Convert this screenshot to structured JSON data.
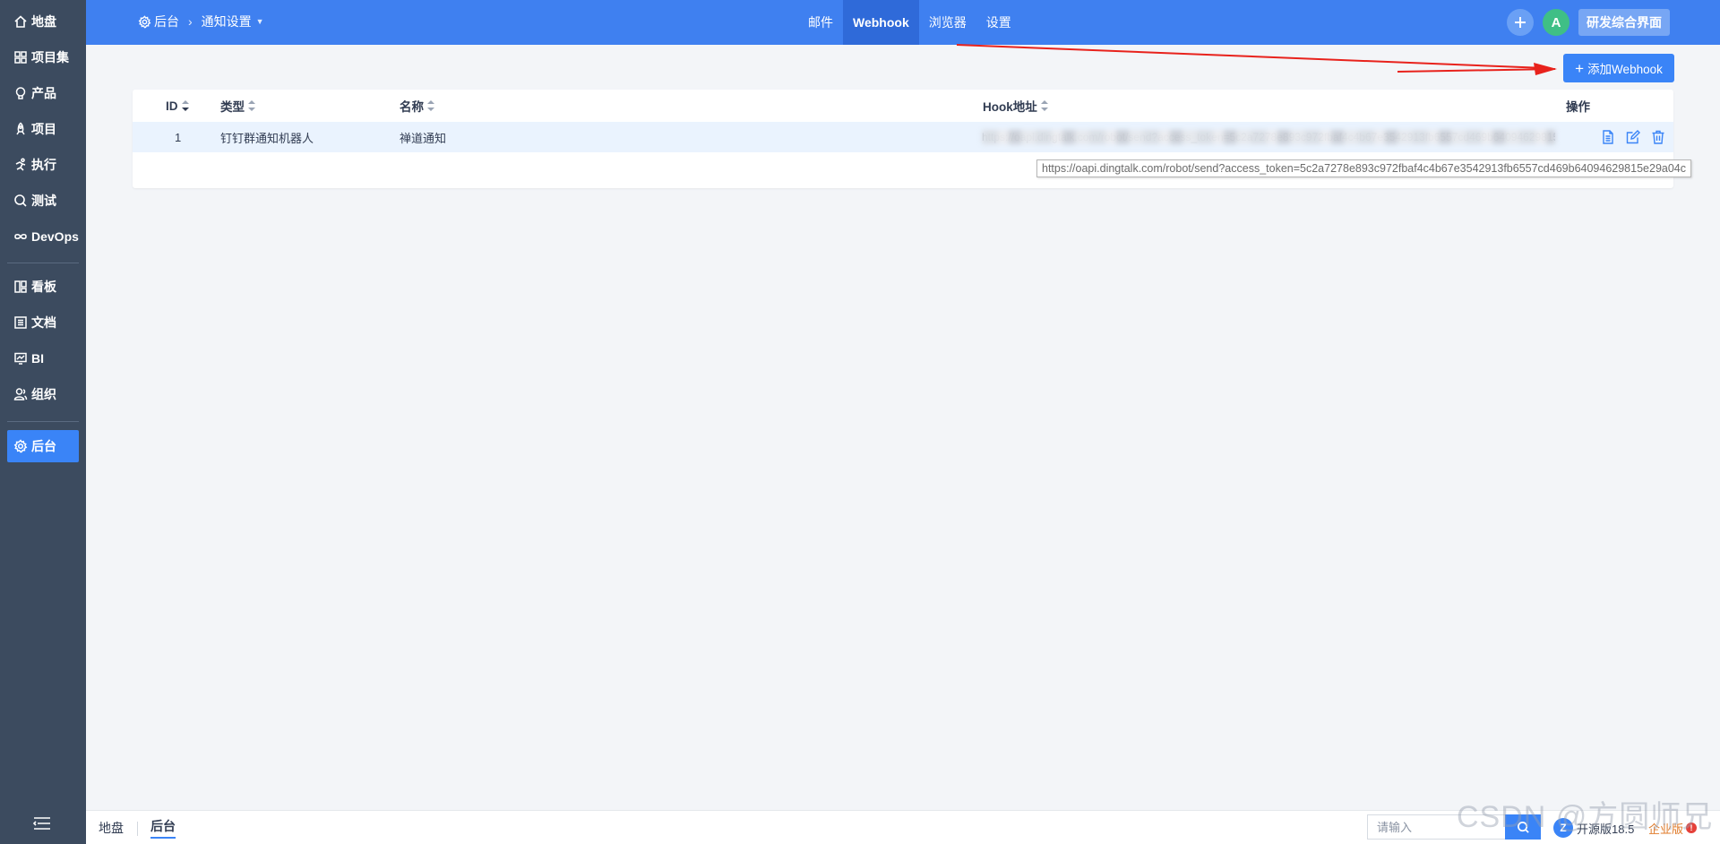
{
  "sidebar": {
    "items": [
      {
        "label": "地盘",
        "icon": "home-icon"
      },
      {
        "label": "项目集",
        "icon": "grid-icon"
      },
      {
        "label": "产品",
        "icon": "lightbulb-icon"
      },
      {
        "label": "项目",
        "icon": "rocket-icon"
      },
      {
        "label": "执行",
        "icon": "run-icon"
      },
      {
        "label": "测试",
        "icon": "search-bug-icon"
      },
      {
        "label": "DevOps",
        "icon": "infinity-icon"
      },
      {
        "label": "看板",
        "icon": "kanban-icon"
      },
      {
        "label": "文档",
        "icon": "document-icon"
      },
      {
        "label": "BI",
        "icon": "chart-screen-icon"
      },
      {
        "label": "组织",
        "icon": "people-icon"
      },
      {
        "label": "后台",
        "icon": "gear-icon"
      }
    ],
    "active": "后台"
  },
  "header": {
    "breadcrumb_home": "后台",
    "breadcrumb_current": "通知设置",
    "tabs": [
      "邮件",
      "Webhook",
      "浏览器",
      "设置"
    ],
    "active_tab": "Webhook",
    "avatar_letter": "A",
    "switch_label": "研发综合界面"
  },
  "toolbar": {
    "add_label": "添加Webhook"
  },
  "table": {
    "columns": [
      "ID",
      "类型",
      "名称",
      "Hook地址",
      "操作"
    ],
    "rows": [
      {
        "id": "1",
        "type": "钉钉群通知机器人",
        "name": "禅道通知",
        "url": "https://oapi.dingtalk.com/robot/send?access_token=5c2a7278e893c972fbaf4c4b67e3542913fb6557cd469b64094629815e29a04c"
      }
    ]
  },
  "tooltip": {
    "text": "https://oapi.dingtalk.com/robot/send?access_token=5c2a7278e893c972fbaf4c4b67e3542913fb6557cd469b64094629815e29a04c"
  },
  "footer": {
    "crumb_home": "地盘",
    "crumb_current": "后台",
    "search_placeholder": "请输入",
    "version": "开源版18.5",
    "edition": "企业版",
    "edition_badge": "!"
  },
  "watermark": "CSDN @方圆师兄",
  "colors": {
    "primary": "#3a84f7",
    "header": "#3f80f0",
    "sidebar": "#3c4b5f",
    "annotation_arrow": "#e8221c"
  }
}
